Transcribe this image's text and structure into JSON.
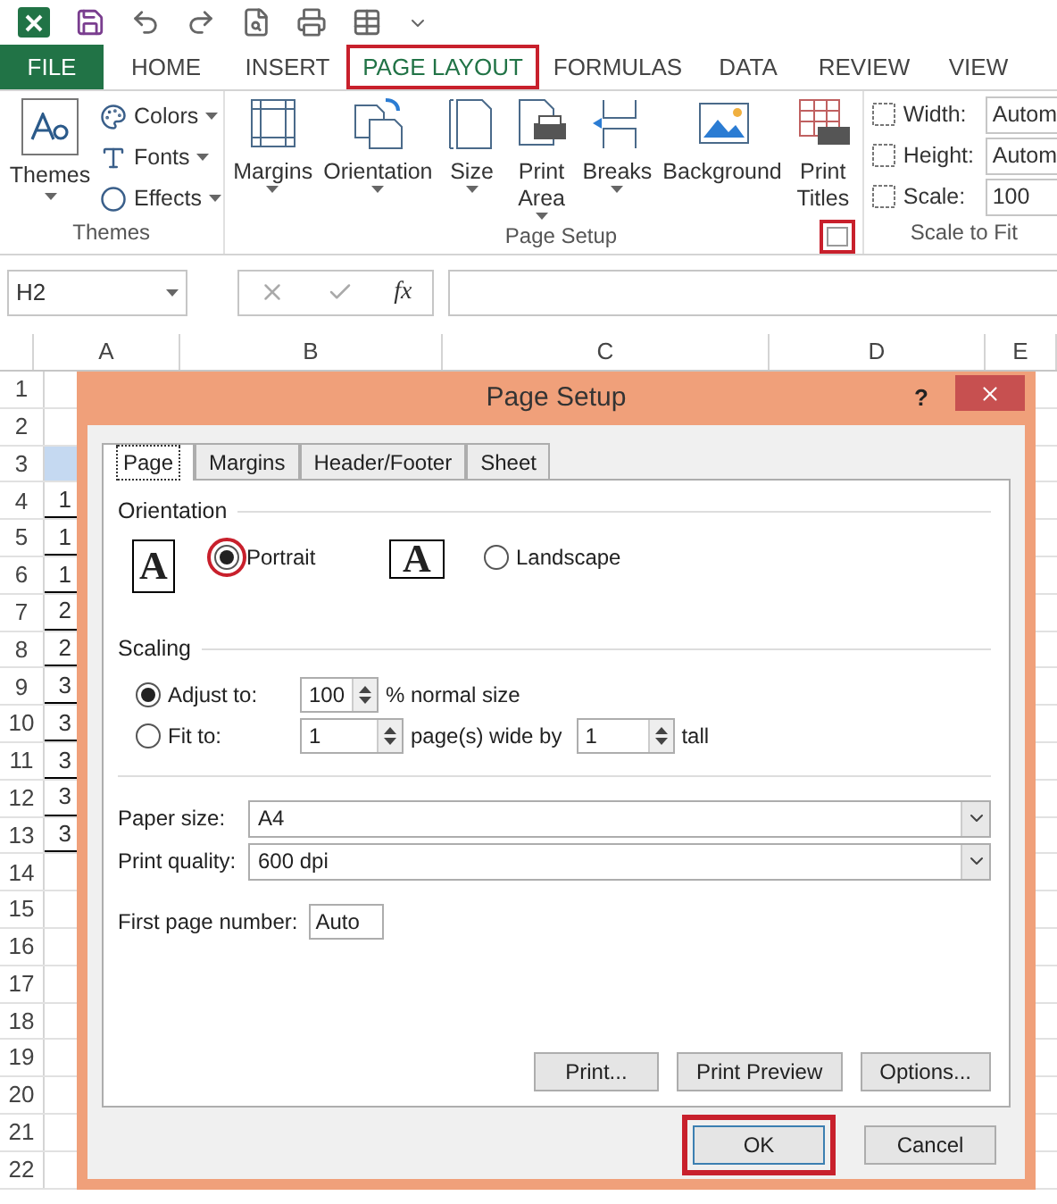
{
  "ribbon": {
    "tabs": [
      {
        "label": "FILE",
        "kind": "file",
        "selected": false,
        "highlighted": false
      },
      {
        "label": "HOME",
        "kind": "tab",
        "selected": false,
        "highlighted": false
      },
      {
        "label": "INSERT",
        "kind": "tab",
        "selected": false,
        "highlighted": false
      },
      {
        "label": "PAGE LAYOUT",
        "kind": "tab",
        "selected": true,
        "highlighted": true
      },
      {
        "label": "FORMULAS",
        "kind": "tab",
        "selected": false,
        "highlighted": false
      },
      {
        "label": "DATA",
        "kind": "tab",
        "selected": false,
        "highlighted": false
      },
      {
        "label": "REVIEW",
        "kind": "tab",
        "selected": false,
        "highlighted": false
      },
      {
        "label": "VIEW",
        "kind": "tab",
        "selected": false,
        "highlighted": false
      }
    ],
    "themes_group": {
      "title": "Themes",
      "themes_button": "Themes",
      "options": [
        "Colors",
        "Fonts",
        "Effects"
      ]
    },
    "page_setup_group": {
      "title": "Page Setup",
      "launcher_highlighted": true,
      "buttons": [
        {
          "label": "Margins",
          "has_menu": true,
          "two_line": false
        },
        {
          "label": "Orientation",
          "has_menu": true,
          "two_line": false
        },
        {
          "label": "Size",
          "has_menu": true,
          "two_line": false
        },
        {
          "label": "Print Area",
          "has_menu": true,
          "two_line": true
        },
        {
          "label": "Breaks",
          "has_menu": true,
          "two_line": false
        },
        {
          "label": "Background",
          "has_menu": false,
          "two_line": false
        },
        {
          "label": "Print Titles",
          "has_menu": false,
          "two_line": true
        }
      ]
    },
    "scale_group": {
      "title": "Scale to Fit",
      "fields": [
        {
          "label": "Width:",
          "value": "Autom"
        },
        {
          "label": "Height:",
          "value": "Autom"
        },
        {
          "label": "Scale:",
          "value": "100"
        }
      ]
    }
  },
  "formula_bar": {
    "name_box": "H2",
    "function_label": "fx"
  },
  "sheet": {
    "columns": [
      "A",
      "B",
      "C",
      "D",
      "E"
    ],
    "rows": [
      {
        "number": "1",
        "value": "",
        "selected": false,
        "bordered": false
      },
      {
        "number": "2",
        "value": "",
        "selected": false,
        "bordered": false
      },
      {
        "number": "3",
        "value": "",
        "selected": true,
        "bordered": false
      },
      {
        "number": "4",
        "value": "1",
        "selected": false,
        "bordered": true
      },
      {
        "number": "5",
        "value": "1",
        "selected": false,
        "bordered": true
      },
      {
        "number": "6",
        "value": "1",
        "selected": false,
        "bordered": true
      },
      {
        "number": "7",
        "value": "2",
        "selected": false,
        "bordered": true
      },
      {
        "number": "8",
        "value": "2",
        "selected": false,
        "bordered": true
      },
      {
        "number": "9",
        "value": "3",
        "selected": false,
        "bordered": true
      },
      {
        "number": "10",
        "value": "3",
        "selected": false,
        "bordered": true
      },
      {
        "number": "11",
        "value": "3",
        "selected": false,
        "bordered": true
      },
      {
        "number": "12",
        "value": "3",
        "selected": false,
        "bordered": true
      },
      {
        "number": "13",
        "value": "3",
        "selected": false,
        "bordered": true
      },
      {
        "number": "14",
        "value": "",
        "selected": false,
        "bordered": false
      },
      {
        "number": "15",
        "value": "",
        "selected": false,
        "bordered": false
      },
      {
        "number": "16",
        "value": "",
        "selected": false,
        "bordered": false
      },
      {
        "number": "17",
        "value": "",
        "selected": false,
        "bordered": false
      },
      {
        "number": "18",
        "value": "",
        "selected": false,
        "bordered": false
      },
      {
        "number": "19",
        "value": "",
        "selected": false,
        "bordered": false
      },
      {
        "number": "20",
        "value": "",
        "selected": false,
        "bordered": false
      },
      {
        "number": "21",
        "value": "",
        "selected": false,
        "bordered": false
      },
      {
        "number": "22",
        "value": "",
        "selected": false,
        "bordered": false
      }
    ]
  },
  "dialog": {
    "title": "Page Setup",
    "help": "?",
    "tabs": [
      {
        "label": "Page",
        "selected": true
      },
      {
        "label": "Margins",
        "selected": false
      },
      {
        "label": "Header/Footer",
        "selected": false
      },
      {
        "label": "Sheet",
        "selected": false
      }
    ],
    "orientation": {
      "title": "Orientation",
      "options": [
        {
          "label": "Portrait",
          "kind": "portrait",
          "glyph": "A",
          "selected": true,
          "highlighted": true
        },
        {
          "label": "Landscape",
          "kind": "landscape",
          "glyph": "A",
          "selected": false,
          "highlighted": false
        }
      ]
    },
    "scaling": {
      "title": "Scaling",
      "adjust": {
        "label": "Adjust to:",
        "selected": true,
        "value": "100",
        "suffix": "% normal size"
      },
      "fit": {
        "label": "Fit to:",
        "selected": false,
        "wide_value": "1",
        "wide_suffix": "page(s) wide by",
        "tall_value": "1",
        "tall_suffix": "tall"
      }
    },
    "paper_size": {
      "label": "Paper size:",
      "value": "A4"
    },
    "print_quality": {
      "label": "Print quality:",
      "value": "600 dpi"
    },
    "first_page_number": {
      "label": "First page number:",
      "value": "Auto"
    },
    "actions": [
      "Print...",
      "Print Preview",
      "Options..."
    ],
    "footer_buttons": [
      {
        "label": "OK",
        "default": true,
        "highlighted": true
      },
      {
        "label": "Cancel",
        "default": false,
        "highlighted": false
      }
    ]
  }
}
